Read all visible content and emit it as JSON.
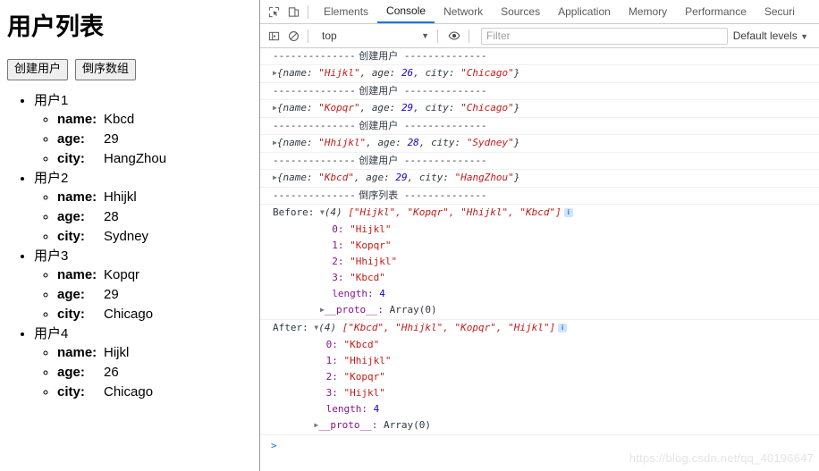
{
  "page": {
    "title": "用户列表",
    "buttons": [
      {
        "label": "创建用户",
        "name": "create-user-button"
      },
      {
        "label": "倒序数组",
        "name": "reverse-array-button"
      }
    ],
    "field_labels": {
      "name": "name:",
      "age": "age:",
      "city": "city:"
    },
    "users": [
      {
        "heading": "用户1",
        "name": "Kbcd",
        "age": "29",
        "city": "HangZhou"
      },
      {
        "heading": "用户2",
        "name": "Hhijkl",
        "age": "28",
        "city": "Sydney"
      },
      {
        "heading": "用户3",
        "name": "Kopqr",
        "age": "29",
        "city": "Chicago"
      },
      {
        "heading": "用户4",
        "name": "Hijkl",
        "age": "26",
        "city": "Chicago"
      }
    ]
  },
  "devtools": {
    "tabs": [
      {
        "label": "Elements",
        "active": false
      },
      {
        "label": "Console",
        "active": true
      },
      {
        "label": "Network",
        "active": false
      },
      {
        "label": "Sources",
        "active": false
      },
      {
        "label": "Application",
        "active": false
      },
      {
        "label": "Memory",
        "active": false
      },
      {
        "label": "Performance",
        "active": false
      },
      {
        "label": "Securi",
        "active": false
      }
    ],
    "toolbar_icons": [
      "inspect-element-icon",
      "device-toolbar-icon"
    ],
    "filterbar": {
      "sidebar_toggle_icon": "console-sidebar-icon",
      "clear_icon": "clear-console-icon",
      "context_value": "top",
      "context_caret": "▼",
      "eye_icon": "live-expression-icon",
      "filter_placeholder": "Filter",
      "filter_value": "",
      "levels_label": "Default levels",
      "levels_caret": "▼"
    },
    "accent_color": "#1a73e8",
    "prompt_glyph": ">",
    "watermark": "https://blog.csdn.net/qq_40196647"
  },
  "console": {
    "separator_text": "--------------",
    "create_label": "创建用户",
    "reverse_label": "倒序列表",
    "obj_keys": {
      "name": "name:",
      "age": "age:",
      "city": "city:"
    },
    "entries": [
      {
        "name": "\"Hijkl\"",
        "age": "26",
        "city": "\"Chicago\""
      },
      {
        "name": "\"Kopqr\"",
        "age": "29",
        "city": "\"Chicago\""
      },
      {
        "name": "\"Hhijkl\"",
        "age": "28",
        "city": "\"Sydney\""
      },
      {
        "name": "\"Kbcd\"",
        "age": "29",
        "city": "\"HangZhou\""
      }
    ],
    "before": {
      "label": "Before:",
      "count": "(4)",
      "preview": "[\"Hijkl\", \"Kopqr\", \"Hhijkl\", \"Kbcd\"]",
      "items": [
        {
          "index": "0:",
          "value": "\"Hijkl\""
        },
        {
          "index": "1:",
          "value": "\"Kopqr\""
        },
        {
          "index": "2:",
          "value": "\"Hhijkl\""
        },
        {
          "index": "3:",
          "value": "\"Kbcd\""
        }
      ],
      "length_key": "length:",
      "length_value": "4",
      "proto_key": "__proto__:",
      "proto_value": "Array(0)"
    },
    "after": {
      "label": "After:",
      "count": "(4)",
      "preview": "[\"Kbcd\", \"Hhijkl\", \"Kopqr\", \"Hijkl\"]",
      "items": [
        {
          "index": "0:",
          "value": "\"Kbcd\""
        },
        {
          "index": "1:",
          "value": "\"Hhijkl\""
        },
        {
          "index": "2:",
          "value": "\"Kopqr\""
        },
        {
          "index": "3:",
          "value": "\"Hijkl\""
        }
      ],
      "length_key": "length:",
      "length_value": "4",
      "proto_key": "__proto__:",
      "proto_value": "Array(0)"
    },
    "badge_glyph": "i"
  }
}
